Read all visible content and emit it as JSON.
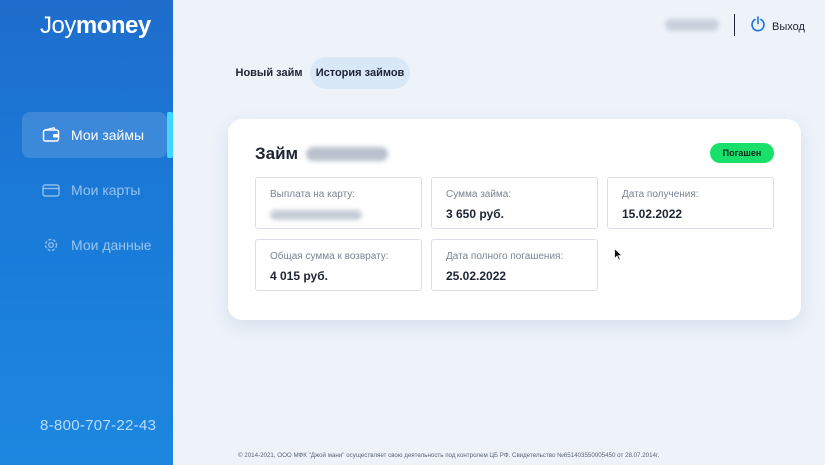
{
  "app": {
    "logo_part1": "Joy",
    "logo_part2": "money"
  },
  "sidebar": {
    "items": [
      {
        "label": "Мои займы",
        "icon": "wallet-icon",
        "active": true
      },
      {
        "label": "Мои карты",
        "icon": "card-icon",
        "active": false
      },
      {
        "label": "Мои данные",
        "icon": "gear-icon",
        "active": false
      }
    ],
    "phone": "8-800-707-22-43"
  },
  "header": {
    "logout_label": "Выход"
  },
  "tabs": [
    {
      "label": "Новый займ",
      "active": false
    },
    {
      "label": "История займов",
      "active": true
    }
  ],
  "loan": {
    "title": "Займ",
    "status": "Погашен",
    "fields": {
      "card_payout": {
        "label": "Выплата на карту:"
      },
      "amount": {
        "label": "Сумма займа:",
        "value": "3 650 руб."
      },
      "received_date": {
        "label": "Дата получения:",
        "value": "15.02.2022"
      },
      "total_return": {
        "label": "Общая сумма к возврату:",
        "value": "4 015 руб."
      },
      "full_repayment_date": {
        "label": "Дата полного погашения:",
        "value": "25.02.2022"
      }
    }
  },
  "footer": {
    "text": "© 2014-2021, ООО МФК \"Джой мани\" осуществляет свою деятельность под контролем ЦБ РФ. Свидетельство №651403550005450 от 28.07.2014г."
  },
  "colors": {
    "sidebar_top": "#1f6dcc",
    "sidebar_bottom": "#1d87e0",
    "accent_bar": "#43d7ff",
    "status_green": "#19e06b",
    "page_bg": "#eef3fa"
  }
}
